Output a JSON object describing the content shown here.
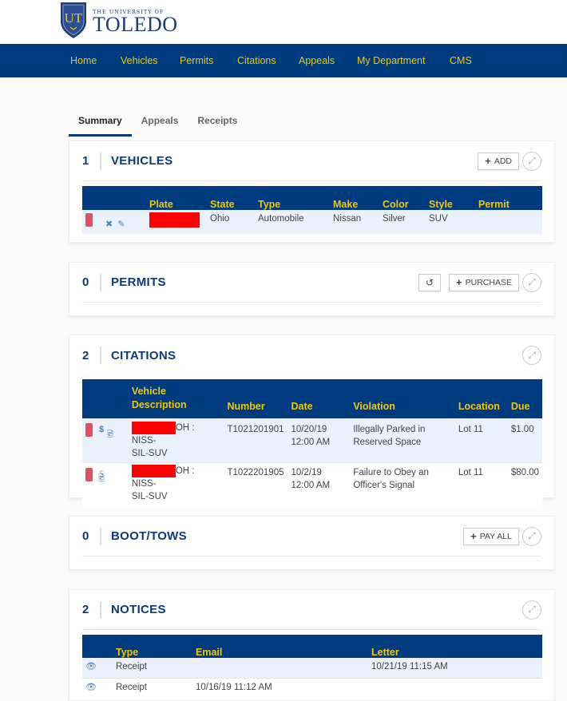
{
  "header": {
    "logo": {
      "monogram": "UT",
      "small_text": "THE UNIVERSITY OF",
      "big_text": "TOLEDO"
    }
  },
  "nav": {
    "items": [
      {
        "label": "Home"
      },
      {
        "label": "Vehicles"
      },
      {
        "label": "Permits"
      },
      {
        "label": "Citations"
      },
      {
        "label": "Appeals"
      },
      {
        "label": "My Department"
      },
      {
        "label": "CMS"
      }
    ]
  },
  "tabs": [
    {
      "label": "Summary",
      "active": true
    },
    {
      "label": "Appeals",
      "active": false
    },
    {
      "label": "Receipts",
      "active": false
    }
  ],
  "vehicles": {
    "count": "1",
    "title": "VEHICLES",
    "add_label": "ADD",
    "columns": [
      "Plate",
      "State",
      "Type",
      "Make",
      "Color",
      "Style",
      "Permit"
    ],
    "rows": [
      {
        "plate": "[redacted]",
        "state": "Ohio",
        "type": "Automobile",
        "make": "Nissan",
        "color": "Silver",
        "style": "SUV",
        "permit": ""
      }
    ]
  },
  "permits": {
    "count": "0",
    "title": "PERMITS",
    "purchase_label": "PURCHASE"
  },
  "citations": {
    "count": "2",
    "title": "CITATIONS",
    "columns": [
      "Vehicle Description",
      "Number",
      "Date",
      "Violation",
      "Location",
      "Due"
    ],
    "rows": [
      {
        "vehicle_suffix": "OH : NISS-",
        "vehicle_line2": "SIL-SUV",
        "number": "T1021201901",
        "date": "10/20/19",
        "time": "12:00 AM",
        "violation": "Illegally Parked in Reserved Space",
        "location": "Lot 11",
        "due": "$1.00",
        "payable": true
      },
      {
        "vehicle_suffix": "OH : NISS-",
        "vehicle_line2": "SIL-SUV",
        "number": "T1022201905",
        "date": "10/2/19",
        "time": "12:00 AM",
        "violation": "Failure to Obey an Officer's Signal",
        "location": "Lot 11",
        "due": "$80.00",
        "payable": false
      }
    ]
  },
  "boot_tows": {
    "count": "0",
    "title": "BOOT/TOWS",
    "pay_all_label": "PAY ALL"
  },
  "notices": {
    "count": "2",
    "title": "NOTICES",
    "columns": [
      "Type",
      "Email",
      "Letter"
    ],
    "rows": [
      {
        "type": "Receipt",
        "email": "",
        "letter": "10/21/19 11:15 AM"
      },
      {
        "type": "Receipt",
        "email": "10/16/19 11:12 AM",
        "letter": ""
      }
    ]
  },
  "colors": {
    "nav_bg": "#003b7f",
    "nav_text": "#f0c808",
    "title": "#0b3a75",
    "row_alt": "#eaf1fa",
    "flag": "#e05060"
  }
}
